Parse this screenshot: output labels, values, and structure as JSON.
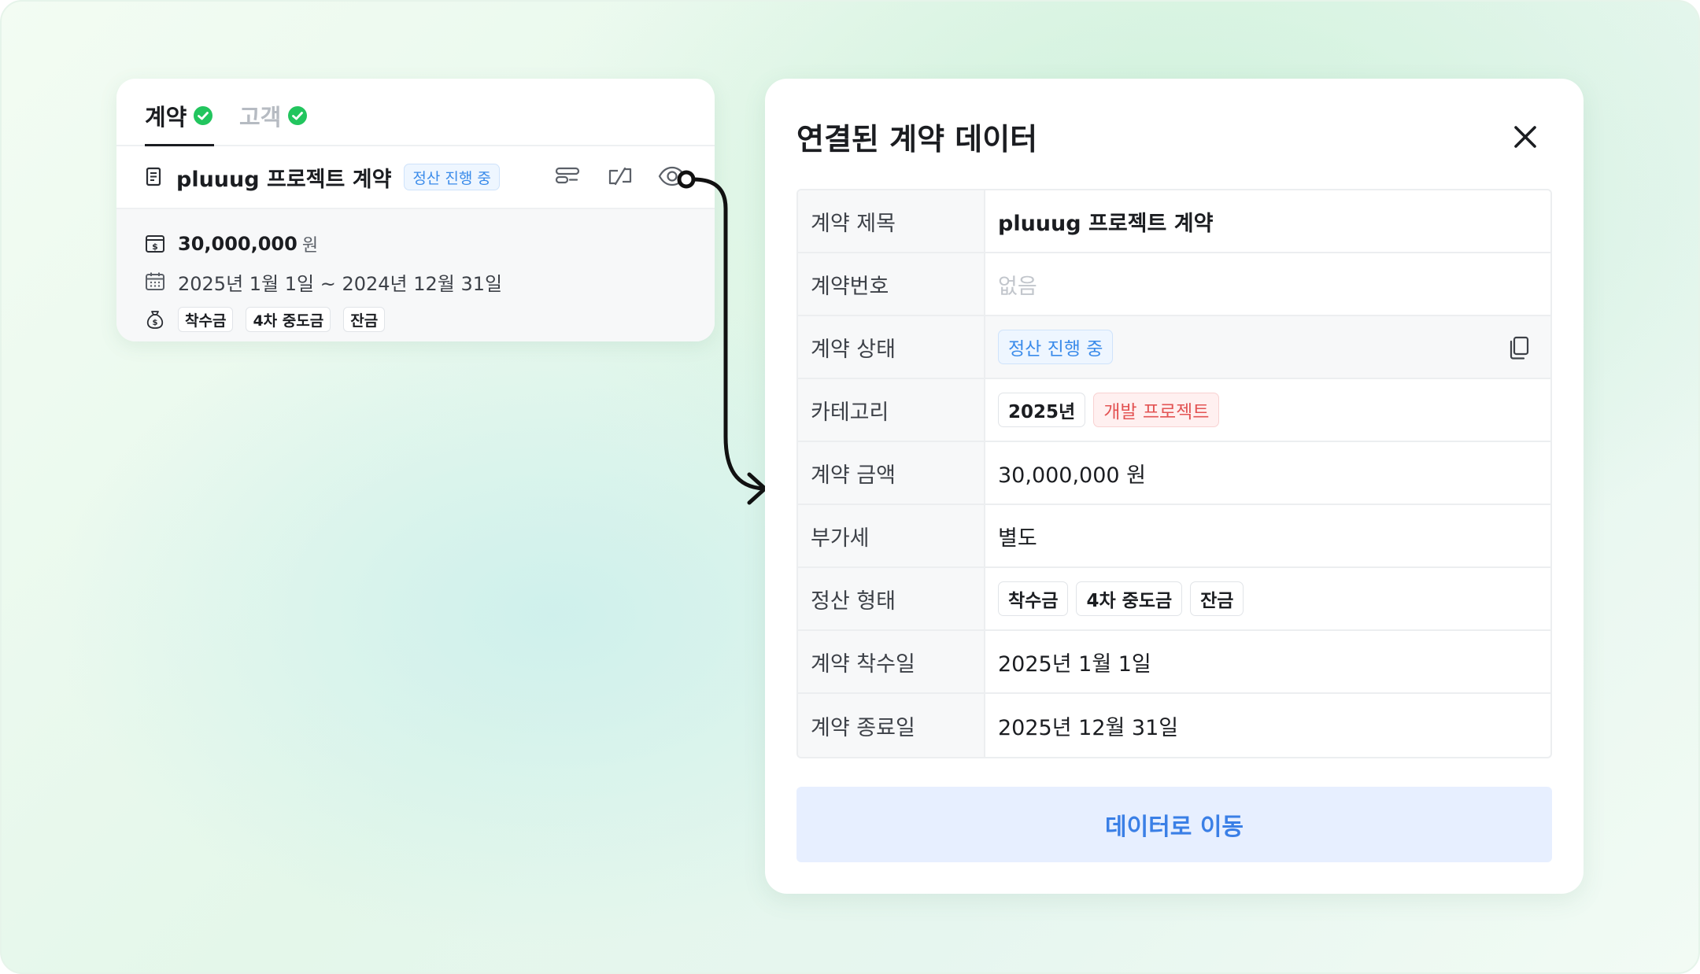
{
  "card": {
    "tabs": [
      {
        "label": "계약",
        "active": true
      },
      {
        "label": "고객",
        "active": false
      }
    ],
    "contract_title": "pluuug 프로젝트 계약",
    "status_badge": "정산 진행 중",
    "amount": "30,000,000",
    "amount_unit": "원",
    "period": "2025년 1월 1일 ~ 2024년 12월 31일",
    "payment_chips": [
      "착수금",
      "4차 중도금",
      "잔금"
    ],
    "actions": [
      "filter-icon",
      "unlink-icon",
      "eye-icon"
    ]
  },
  "panel": {
    "title": "연결된 계약 데이터",
    "rows": {
      "title": {
        "label": "계약 제목",
        "value": "pluuug 프로젝트 계약"
      },
      "number": {
        "label": "계약번호",
        "value": "없음"
      },
      "status": {
        "label": "계약 상태",
        "value": "정산 진행 중"
      },
      "category": {
        "label": "카테고리",
        "chips": [
          "2025년",
          "개발 프로젝트"
        ]
      },
      "amount": {
        "label": "계약 금액",
        "value": "30,000,000 원"
      },
      "vat": {
        "label": "부가세",
        "value": "별도"
      },
      "payment": {
        "label": "정산 형태",
        "chips": [
          "착수금",
          "4차 중도금",
          "잔금"
        ]
      },
      "start": {
        "label": "계약 착수일",
        "value": "2025년 1월 1일"
      },
      "end": {
        "label": "계약 종료일",
        "value": "2025년 12월 31일"
      }
    },
    "goto_button": "데이터로 이동"
  },
  "colors": {
    "accent_blue": "#3a8bea",
    "check_green": "#22c55e",
    "category_red": "#e35454",
    "button_bg": "#e7efff"
  }
}
